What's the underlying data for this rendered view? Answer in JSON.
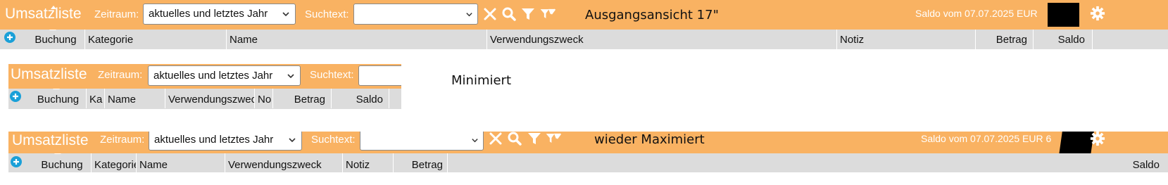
{
  "app_title": "Umsatzliste",
  "zeitraum_label": "Zeitraum:",
  "zeitraum_value": "aktuelles und letztes Jahr",
  "suchtext_label": "Suchtext:",
  "suchtext_value": "",
  "saldo_label": "Saldo vom 07.07.2025 EUR",
  "saldo_label_partial": "Saldo vom 07.07.2025 EUR 6",
  "annotations": {
    "top": "Ausgangsansicht 17\"",
    "middle": "Minimiert",
    "bottom": "wieder Maximiert"
  },
  "columns_full": [
    "Buchung",
    "Kategorie",
    "Name",
    "Verwendungszweck",
    "Notiz",
    "Betrag",
    "Saldo"
  ],
  "columns_min": [
    "Buchung",
    "Ka",
    "Name",
    "Verwendungszwec",
    "No",
    "Betrag",
    "Saldo"
  ],
  "columns_max": [
    "Buchung",
    "Kategorie",
    "Name",
    "Verwendungszweck",
    "Notiz",
    "Betrag",
    "Saldo"
  ],
  "icons": [
    "add-icon",
    "chevron-down-icon",
    "clear-icon",
    "search-icon",
    "filter-icon",
    "filter-reset-icon",
    "gear-icon"
  ],
  "colors": {
    "toolbar": "#f9b262",
    "header": "#dcdcdc",
    "add_icon": "#1aa0d8"
  }
}
